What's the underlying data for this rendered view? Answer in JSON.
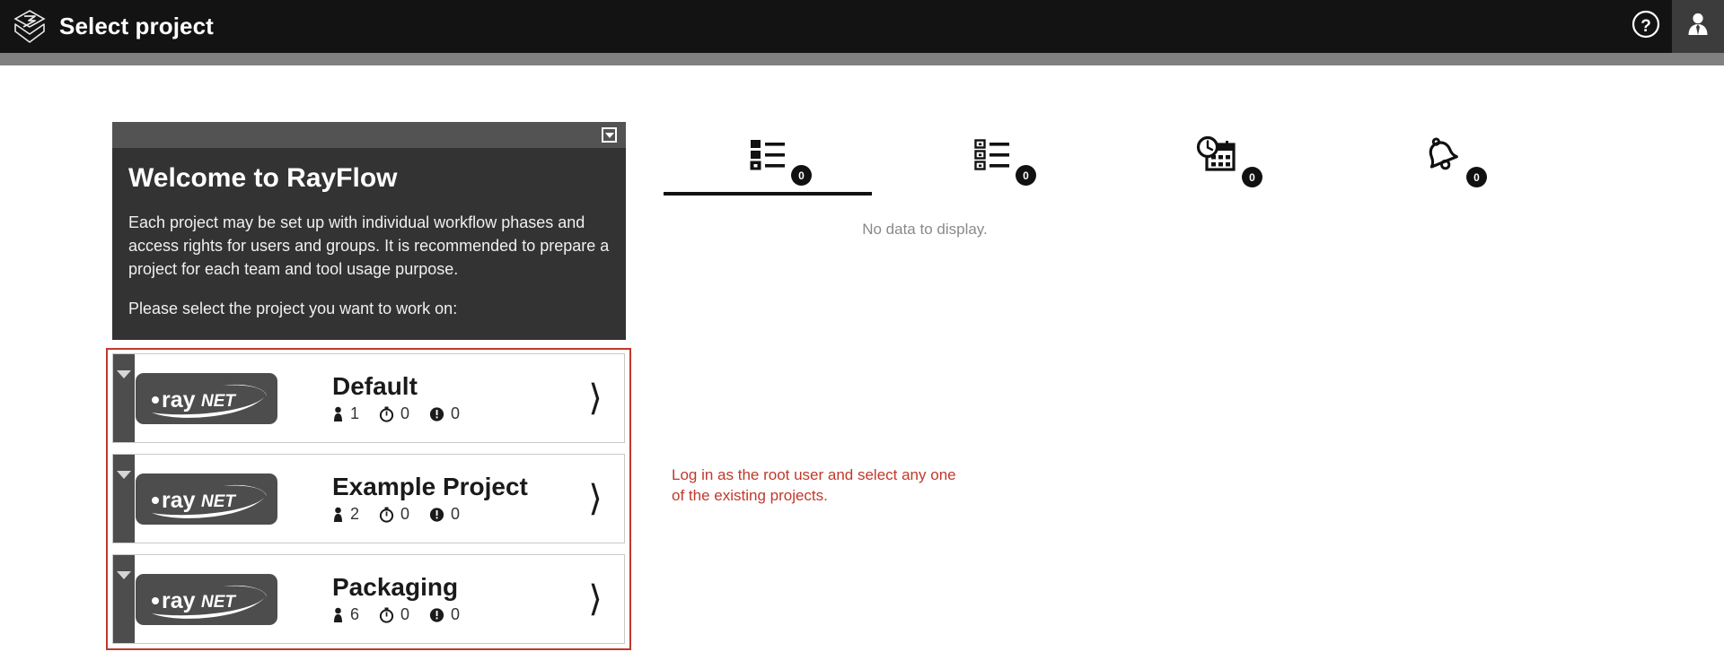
{
  "header": {
    "logo_icon": "rayflow-layers-icon",
    "title": "Select project",
    "help_icon": "question-circle-icon",
    "user_icon": "user-avatar-icon"
  },
  "welcome": {
    "collapse_icon": "chevron-down-box-icon",
    "heading": "Welcome to RayFlow",
    "paragraph_1": "Each project may be set up with individual workflow phases and access rights for users and groups. It is recommended to prepare a project for each team and tool usage purpose.",
    "paragraph_2": "Please select the project you want to work on:"
  },
  "projects": {
    "logo_text_primary": "•ray",
    "logo_text_secondary": "NET",
    "expand_icon": "caret-down-icon",
    "open_icon": "chevron-right-icon",
    "stat_icons": {
      "users": "person-icon",
      "pending": "stopwatch-icon",
      "overdue": "alert-clock-icon"
    },
    "items": [
      {
        "name": "Default",
        "users": "1",
        "pending": "0",
        "overdue": "0"
      },
      {
        "name": "Example Project",
        "users": "2",
        "pending": "0",
        "overdue": "0"
      },
      {
        "name": "Packaging",
        "users": "6",
        "pending": "0",
        "overdue": "0"
      }
    ]
  },
  "dashboard": {
    "tabs": [
      {
        "icon": "checked-task-list-icon",
        "badge": "0",
        "active": true
      },
      {
        "icon": "unchecked-task-list-icon",
        "badge": "0",
        "active": false
      },
      {
        "icon": "calendar-clock-icon",
        "badge": "0",
        "active": false
      },
      {
        "icon": "notification-bell-icon",
        "badge": "0",
        "active": false
      }
    ],
    "empty_message": "No data to display."
  },
  "annotation": {
    "text": "Log in as the root user and select any one of the existing projects."
  },
  "colors": {
    "header_bg": "#131313",
    "header_underbar": "#808080",
    "panel_bg": "#333333",
    "panel_header_bg": "#535353",
    "accent_red": "#c0392b",
    "logo_bg": "#4d4d4d",
    "badge_bg": "#111111"
  }
}
